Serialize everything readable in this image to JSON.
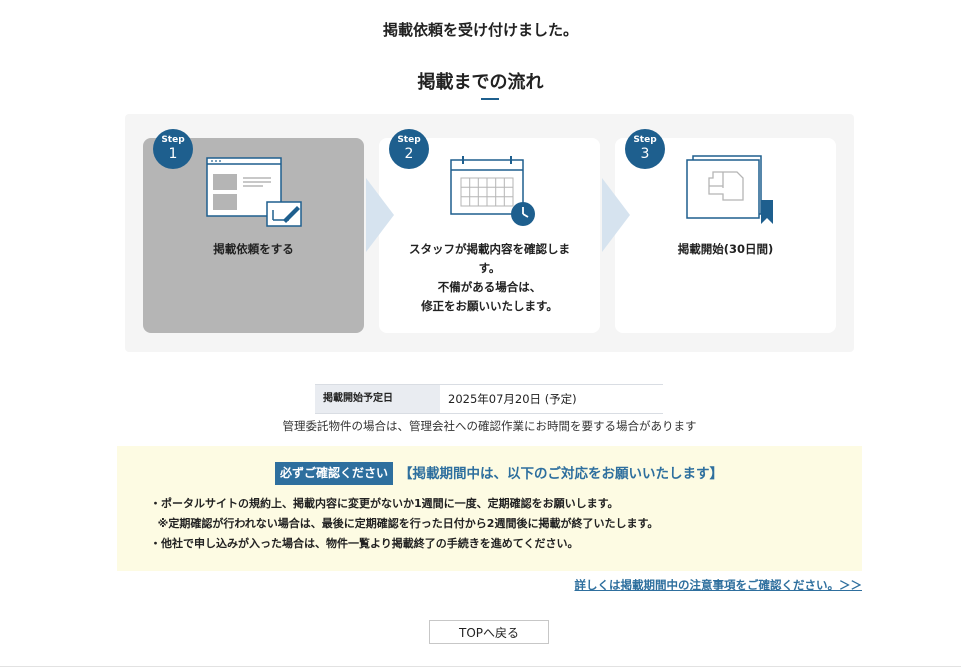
{
  "header": {
    "confirmation": "掲載依頼を受け付けました。",
    "flow_title": "掲載までの流れ"
  },
  "steps": [
    {
      "step_label": "Step",
      "number": "1",
      "text": "掲載依頼をする",
      "icon": "web-form-edit-icon"
    },
    {
      "step_label": "Step",
      "number": "2",
      "text": "スタッフが掲載内容を確認しま\nす。\n不備がある場合は、\n修正をお願いいたします。",
      "icon": "calendar-clock-icon"
    },
    {
      "step_label": "Step",
      "number": "3",
      "text": "掲載開始(30日間)",
      "icon": "floorplan-bookmark-icon"
    }
  ],
  "schedule": {
    "label": "掲載開始予定日",
    "value": "2025年07月20日 (予定)",
    "note": "管理委託物件の場合は、管理会社への確認作業にお時間を要する場合があります"
  },
  "notice": {
    "badge": "必ずご確認ください",
    "heading": "【掲載期間中は、以下のご対応をお願いいたします】",
    "items": [
      "・ポータルサイトの規約上、掲載内容に変更がないか1週間に一度、定期確認をお願いします。",
      "  ※定期確認が行われない場合は、最後に定期確認を行った日付から2週間後に掲載が終了いたします。",
      "・他社で申し込みが入った場合は、物件一覧より掲載終了の手続きを進めてください。"
    ]
  },
  "link": {
    "detail": "詳しくは掲載期間中の注意事項をご確認ください。＞＞"
  },
  "buttons": {
    "top": "TOPへ戻る"
  },
  "colors": {
    "accent": "#1e5f8e",
    "link": "#2e6f9e",
    "notice_bg": "#fdfbe3",
    "active_step": "#b5b5b5"
  }
}
